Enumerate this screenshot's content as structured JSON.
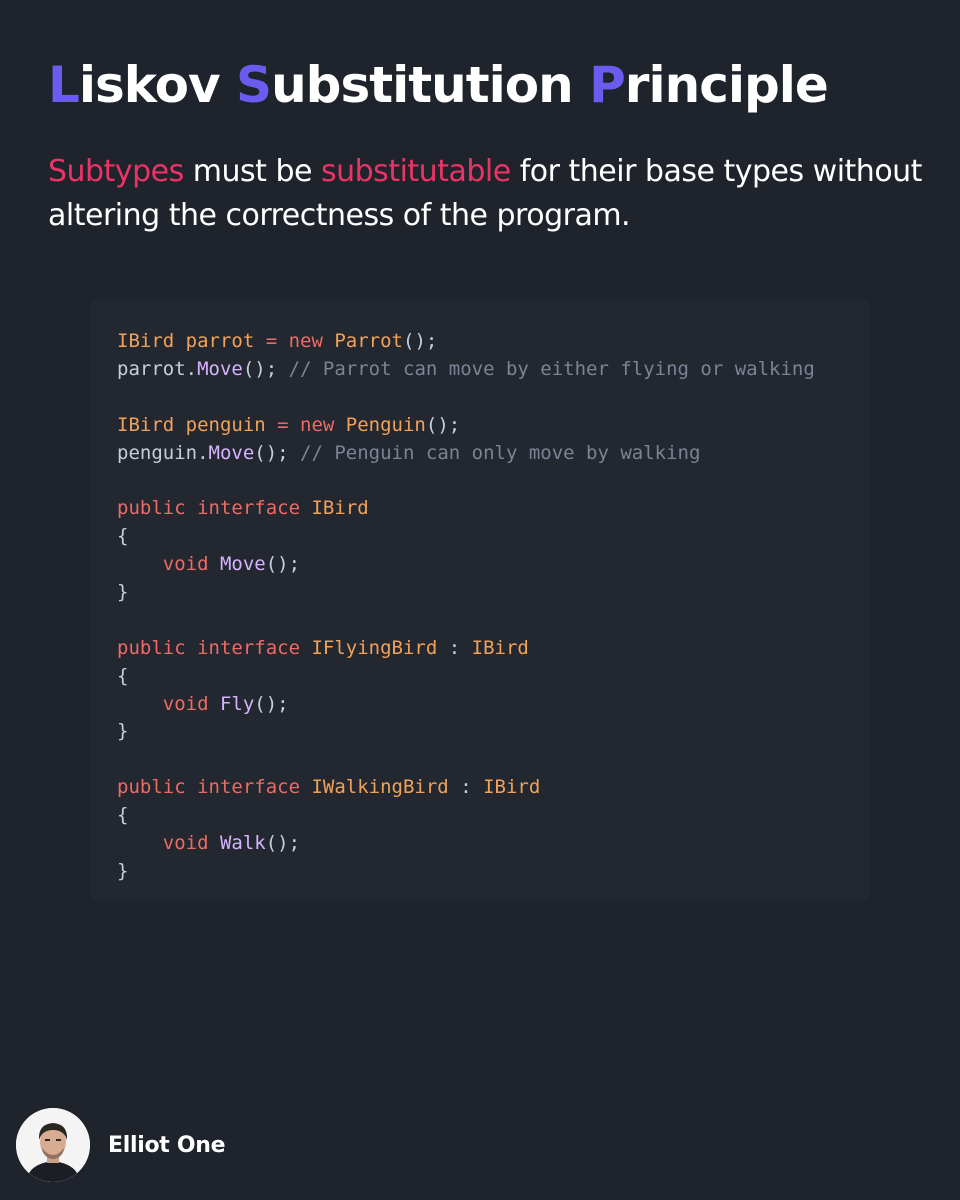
{
  "title": {
    "parts": [
      {
        "initial": "L",
        "rest": "iskov "
      },
      {
        "initial": "S",
        "rest": "ubstitution "
      },
      {
        "initial": "P",
        "rest": "rinciple"
      }
    ]
  },
  "subtitle": {
    "highlight_1": "Subtypes",
    "text_1": " must be ",
    "highlight_2": "substitutable",
    "text_2": " for their base types without altering the correctness of the program."
  },
  "code": {
    "lines": [
      [
        {
          "t": "type",
          "v": "IBird parrot"
        },
        {
          "t": "keyword",
          "v": " = new "
        },
        {
          "t": "type",
          "v": "Parrot"
        },
        {
          "t": "plain",
          "v": "();"
        }
      ],
      [
        {
          "t": "plain",
          "v": "parrot."
        },
        {
          "t": "method",
          "v": "Move"
        },
        {
          "t": "plain",
          "v": "(); "
        },
        {
          "t": "comment",
          "v": "// Parrot can move by either flying or walking"
        }
      ],
      [],
      [
        {
          "t": "type",
          "v": "IBird penguin"
        },
        {
          "t": "keyword",
          "v": " = new "
        },
        {
          "t": "type",
          "v": "Penguin"
        },
        {
          "t": "plain",
          "v": "();"
        }
      ],
      [
        {
          "t": "plain",
          "v": "penguin."
        },
        {
          "t": "method",
          "v": "Move"
        },
        {
          "t": "plain",
          "v": "(); "
        },
        {
          "t": "comment",
          "v": "// Penguin can only move by walking"
        }
      ],
      [],
      [
        {
          "t": "keyword",
          "v": "public interface "
        },
        {
          "t": "type",
          "v": "IBird"
        }
      ],
      [
        {
          "t": "plain",
          "v": "{"
        }
      ],
      [
        {
          "t": "plain",
          "v": "    "
        },
        {
          "t": "keyword",
          "v": "void "
        },
        {
          "t": "method",
          "v": "Move"
        },
        {
          "t": "plain",
          "v": "();"
        }
      ],
      [
        {
          "t": "plain",
          "v": "}"
        }
      ],
      [],
      [
        {
          "t": "keyword",
          "v": "public interface "
        },
        {
          "t": "type",
          "v": "IFlyingBird"
        },
        {
          "t": "plain",
          "v": " : "
        },
        {
          "t": "type",
          "v": "IBird"
        }
      ],
      [
        {
          "t": "plain",
          "v": "{"
        }
      ],
      [
        {
          "t": "plain",
          "v": "    "
        },
        {
          "t": "keyword",
          "v": "void "
        },
        {
          "t": "method",
          "v": "Fly"
        },
        {
          "t": "plain",
          "v": "();"
        }
      ],
      [
        {
          "t": "plain",
          "v": "}"
        }
      ],
      [],
      [
        {
          "t": "keyword",
          "v": "public interface "
        },
        {
          "t": "type",
          "v": "IWalkingBird"
        },
        {
          "t": "plain",
          "v": " : "
        },
        {
          "t": "type",
          "v": "IBird"
        }
      ],
      [
        {
          "t": "plain",
          "v": "{"
        }
      ],
      [
        {
          "t": "plain",
          "v": "    "
        },
        {
          "t": "keyword",
          "v": "void "
        },
        {
          "t": "method",
          "v": "Walk"
        },
        {
          "t": "plain",
          "v": "();"
        }
      ],
      [
        {
          "t": "plain",
          "v": "}"
        }
      ]
    ]
  },
  "author": {
    "name": "Elliot One"
  },
  "colors": {
    "background": "#1f232b",
    "code_panel": "#23272f",
    "title_initial": "#6b5cf0",
    "subtitle_highlight": "#ea3465",
    "code_keyword": "#ec6b66",
    "code_type": "#f1a25a",
    "code_method": "#d6b3ff",
    "code_comment": "#7b8494"
  }
}
